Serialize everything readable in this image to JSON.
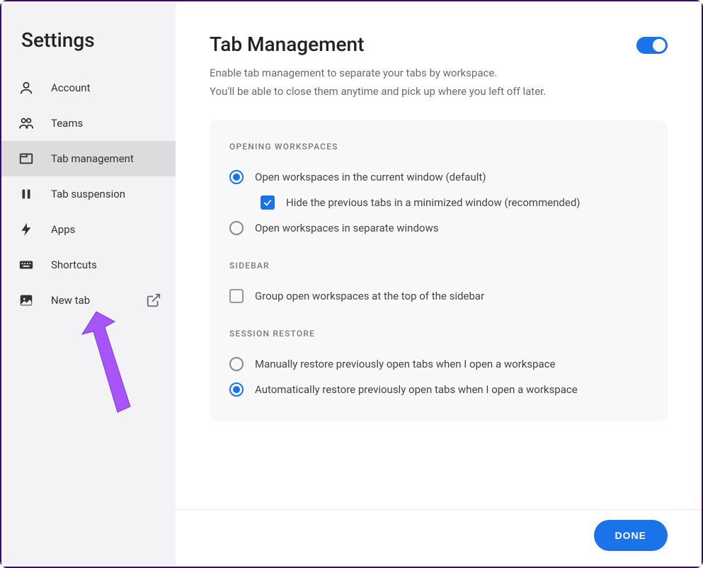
{
  "sidebar": {
    "title": "Settings",
    "items": [
      {
        "label": "Account"
      },
      {
        "label": "Teams"
      },
      {
        "label": "Tab management"
      },
      {
        "label": "Tab suspension"
      },
      {
        "label": "Apps"
      },
      {
        "label": "Shortcuts"
      },
      {
        "label": "New tab"
      }
    ],
    "active_index": 2
  },
  "main": {
    "title": "Tab Management",
    "toggle_on": true,
    "description_line1": "Enable tab management to separate your tabs by workspace.",
    "description_line2": "You'll be able to close them anytime and pick up where you left off later.",
    "sections": {
      "opening_workspaces": {
        "heading": "OPENING WORKSPACES",
        "option_current": "Open workspaces in the current window (default)",
        "option_hide": "Hide the previous tabs in a minimized window (recommended)",
        "option_separate": "Open workspaces in separate windows"
      },
      "sidebar": {
        "heading": "SIDEBAR",
        "option_group": "Group open workspaces at the top of the sidebar"
      },
      "session_restore": {
        "heading": "SESSION RESTORE",
        "option_manual": "Manually restore previously open tabs when I open a workspace",
        "option_auto": "Automatically restore previously open tabs when I open a workspace"
      }
    }
  },
  "footer": {
    "done_label": "DONE"
  },
  "annotation": {
    "arrow_color": "#a855f7"
  }
}
